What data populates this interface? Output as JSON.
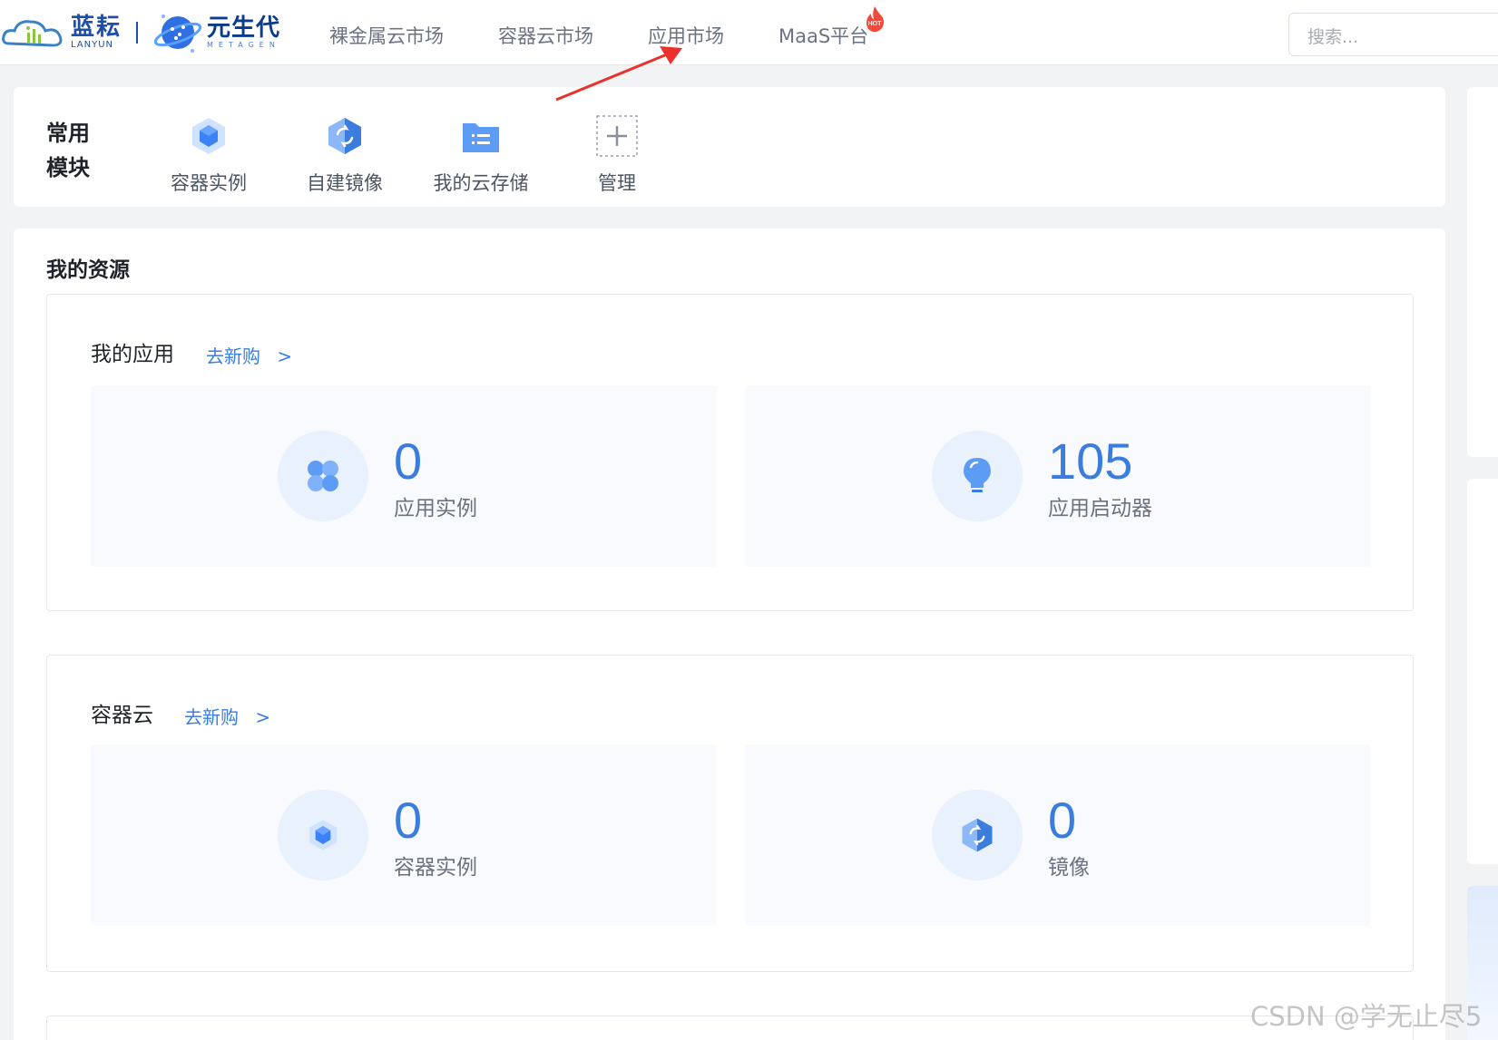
{
  "header": {
    "logo_cn": "蓝耘",
    "logo_en": "LANYUN",
    "brand_cn": "元生代",
    "brand_en": "METAGEN",
    "nav": [
      {
        "label": "裸金属云市场"
      },
      {
        "label": "容器云市场"
      },
      {
        "label": "应用市场"
      },
      {
        "label": "MaaS平台",
        "badge": "HOT"
      }
    ],
    "search_placeholder": "搜索..."
  },
  "common_modules": {
    "title": "常用\n模块",
    "items": [
      {
        "label": "容器实例",
        "icon": "cube-icon"
      },
      {
        "label": "自建镜像",
        "icon": "image-mirror-icon"
      },
      {
        "label": "我的云存储",
        "icon": "folder-list-icon"
      },
      {
        "label": "管理",
        "icon": "plus-icon"
      }
    ]
  },
  "resources": {
    "title": "我的资源",
    "sections": [
      {
        "title": "我的应用",
        "link": "去新购",
        "link_arrow": ">",
        "stats": [
          {
            "value": "0",
            "label": "应用实例",
            "icon": "grid-icon"
          },
          {
            "value": "105",
            "label": "应用启动器",
            "icon": "lightbulb-icon"
          }
        ]
      },
      {
        "title": "容器云",
        "link": "去新购",
        "link_arrow": ">",
        "stats": [
          {
            "value": "0",
            "label": "容器实例",
            "icon": "cube-icon"
          },
          {
            "value": "0",
            "label": "镜像",
            "icon": "image-mirror-icon"
          }
        ]
      }
    ]
  },
  "watermark": "CSDN @学无止尽5",
  "colors": {
    "accent": "#3b7ddd",
    "arrow": "#e8322b",
    "hot": "#f04b3a"
  }
}
